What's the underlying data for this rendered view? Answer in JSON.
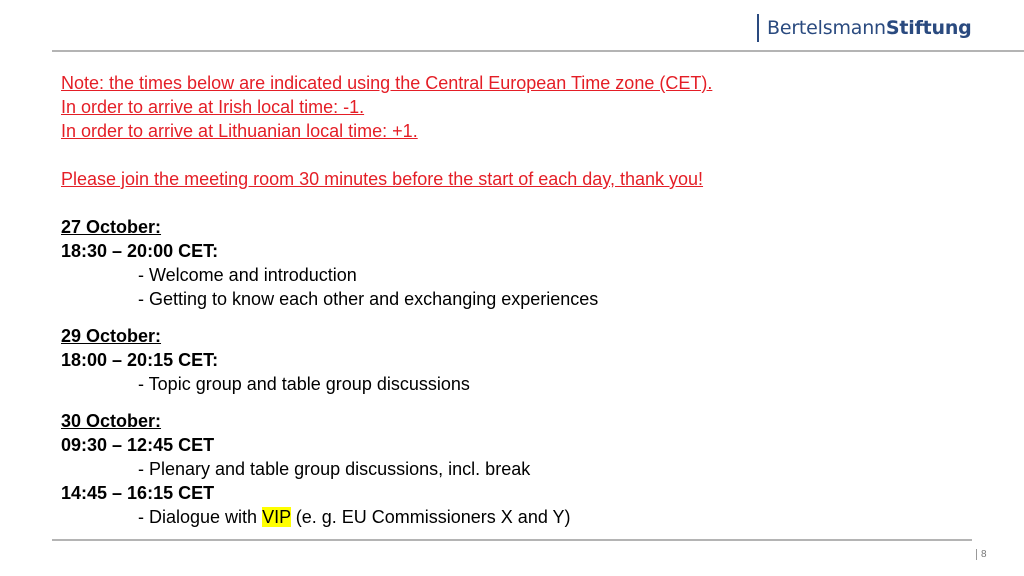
{
  "header": {
    "logo_light": "Bertelsmann",
    "logo_bold": "Stiftung"
  },
  "notes": {
    "lines": [
      "Note: the times below are indicated using the Central European Time zone (CET).",
      "In order to arrive at Irish local time: -1.",
      "In order to arrive at Lithuanian local time: +1."
    ],
    "reminder": "Please join the meeting room 30 minutes before the start of each day, thank you!"
  },
  "schedule": [
    {
      "date": "27 October:",
      "slots": [
        {
          "time": "18:30 – 20:00 CET:",
          "items": [
            "- Welcome and introduction",
            "- Getting to know each other and exchanging experiences"
          ]
        }
      ]
    },
    {
      "date": "29 October:",
      "slots": [
        {
          "time": "18:00 – 20:15 CET:",
          "items": [
            "- Topic group and table group discussions"
          ]
        }
      ]
    },
    {
      "date": "30 October:",
      "slots": [
        {
          "time": "09:30 – 12:45 CET",
          "items": [
            "- Plenary and table group discussions, incl. break"
          ]
        },
        {
          "time": "14:45 – 16:15 CET",
          "items_rich": {
            "before": "- Dialogue with ",
            "highlight": "VIP",
            "after": " (e. g. EU Commissioners X and Y)"
          }
        }
      ]
    }
  ],
  "footer": {
    "page_number": "8"
  },
  "colors": {
    "brand": "#2a4a7f",
    "note_red": "#e41e26",
    "highlight": "#ffff00"
  }
}
